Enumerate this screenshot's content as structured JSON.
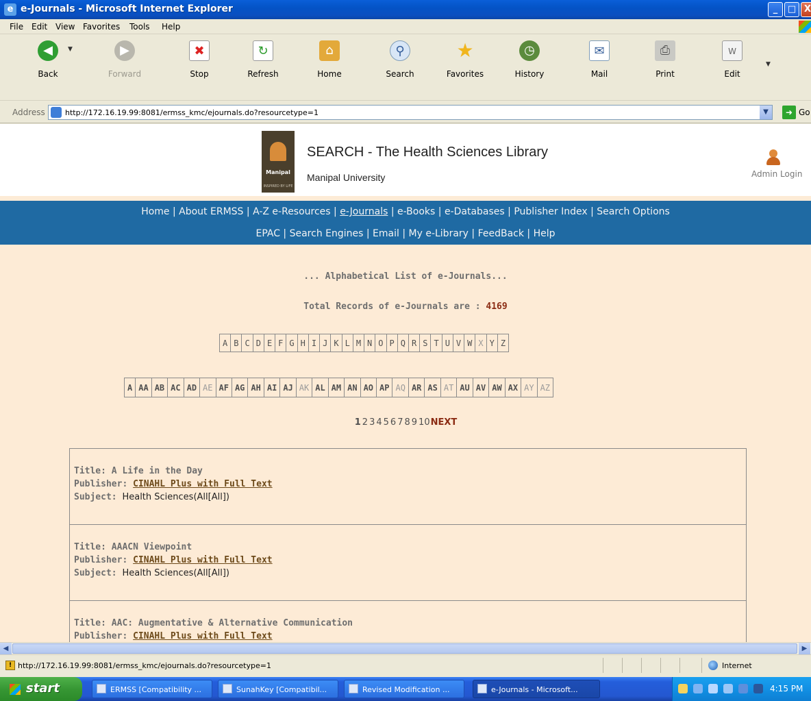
{
  "window": {
    "title": "e-Journals - Microsoft Internet Explorer",
    "minimize": "_",
    "maximize": "□",
    "close": "X"
  },
  "menu": [
    "File",
    "Edit",
    "View",
    "Favorites",
    "Tools",
    "Help"
  ],
  "toolbar": {
    "back": "Back",
    "forward": "Forward",
    "stop": "Stop",
    "refresh": "Refresh",
    "home": "Home",
    "search": "Search",
    "favorites": "Favorites",
    "history": "History",
    "mail": "Mail",
    "print": "Print",
    "edit": "Edit"
  },
  "address": {
    "label": "Address",
    "url": "http://172.16.19.99:8081/ermss_kmc/ejournals.do?resourcetype=1",
    "go": "Go"
  },
  "site": {
    "logo_name": "Manipal",
    "logo_tagline": "INSPIRED BY LIFE",
    "title": "SEARCH - The Health Sciences Library",
    "subtitle": "Manipal University",
    "admin_login": "Admin Login"
  },
  "nav": {
    "row1": [
      {
        "label": "Home",
        "current": false
      },
      {
        "label": "About ERMSS",
        "current": false
      },
      {
        "label": "A-Z e-Resources",
        "current": false
      },
      {
        "label": "e-Journals",
        "current": true
      },
      {
        "label": "e-Books",
        "current": false
      },
      {
        "label": "e-Databases",
        "current": false
      },
      {
        "label": "Publisher Index",
        "current": false
      },
      {
        "label": "Search Options",
        "current": false
      }
    ],
    "row2": [
      {
        "label": "EPAC",
        "current": false
      },
      {
        "label": "Search Engines",
        "current": false
      },
      {
        "label": "Email",
        "current": false
      },
      {
        "label": "My e-Library",
        "current": false
      },
      {
        "label": "FeedBack",
        "current": false
      },
      {
        "label": "Help",
        "current": false
      }
    ],
    "separator": "|"
  },
  "list": {
    "heading": "... Alphabetical List of e-Journals...",
    "total_label": "Total Records of e-Journals are :",
    "total_count": "4169"
  },
  "letters_row1": [
    {
      "t": "A",
      "dim": false
    },
    {
      "t": "B",
      "dim": false
    },
    {
      "t": "C",
      "dim": false
    },
    {
      "t": "D",
      "dim": false
    },
    {
      "t": "E",
      "dim": false
    },
    {
      "t": "F",
      "dim": false
    },
    {
      "t": "G",
      "dim": false
    },
    {
      "t": "H",
      "dim": false
    },
    {
      "t": "I",
      "dim": false
    },
    {
      "t": "J",
      "dim": false
    },
    {
      "t": "K",
      "dim": false
    },
    {
      "t": "L",
      "dim": false
    },
    {
      "t": "M",
      "dim": false
    },
    {
      "t": "N",
      "dim": false
    },
    {
      "t": "O",
      "dim": false
    },
    {
      "t": "P",
      "dim": false
    },
    {
      "t": "Q",
      "dim": false
    },
    {
      "t": "R",
      "dim": false
    },
    {
      "t": "S",
      "dim": false
    },
    {
      "t": "T",
      "dim": false
    },
    {
      "t": "U",
      "dim": false
    },
    {
      "t": "V",
      "dim": false
    },
    {
      "t": "W",
      "dim": false
    },
    {
      "t": "X",
      "dim": true
    },
    {
      "t": "Y",
      "dim": false
    },
    {
      "t": "Z",
      "dim": false
    }
  ],
  "letters_row2": [
    {
      "t": "A",
      "dim": false
    },
    {
      "t": "AA",
      "dim": false
    },
    {
      "t": "AB",
      "dim": false
    },
    {
      "t": "AC",
      "dim": false
    },
    {
      "t": "AD",
      "dim": false
    },
    {
      "t": "AE",
      "dim": true
    },
    {
      "t": "AF",
      "dim": false
    },
    {
      "t": "AG",
      "dim": false
    },
    {
      "t": "AH",
      "dim": false
    },
    {
      "t": "AI",
      "dim": false
    },
    {
      "t": "AJ",
      "dim": false
    },
    {
      "t": "AK",
      "dim": true
    },
    {
      "t": "AL",
      "dim": false
    },
    {
      "t": "AM",
      "dim": false
    },
    {
      "t": "AN",
      "dim": false
    },
    {
      "t": "AO",
      "dim": false
    },
    {
      "t": "AP",
      "dim": false
    },
    {
      "t": "AQ",
      "dim": true
    },
    {
      "t": "AR",
      "dim": false
    },
    {
      "t": "AS",
      "dim": false
    },
    {
      "t": "AT",
      "dim": true
    },
    {
      "t": "AU",
      "dim": false
    },
    {
      "t": "AV",
      "dim": false
    },
    {
      "t": "AW",
      "dim": false
    },
    {
      "t": "AX",
      "dim": false
    },
    {
      "t": "AY",
      "dim": true
    },
    {
      "t": "AZ",
      "dim": true
    }
  ],
  "pager": {
    "pages": [
      "1",
      "2",
      "3",
      "4",
      "5",
      "6",
      "7",
      "8",
      "9",
      "10"
    ],
    "current": "1",
    "next": "NEXT"
  },
  "records": [
    {
      "title_label": "Title:",
      "title": "A Life in the Day",
      "publisher_label": "Publisher:",
      "publisher": "CINAHL Plus with Full Text",
      "subject_label": "Subject:",
      "subject": "Health Sciences(All[All])"
    },
    {
      "title_label": "Title:",
      "title": "AAACN Viewpoint",
      "publisher_label": "Publisher:",
      "publisher": "CINAHL Plus with Full Text",
      "subject_label": "Subject:",
      "subject": "Health Sciences(All[All])"
    },
    {
      "title_label": "Title:",
      "title": "AAC: Augmentative & Alternative Communication",
      "publisher_label": "Publisher:",
      "publisher": "CINAHL Plus with Full Text",
      "subject_label": "Subject:",
      "subject": ""
    }
  ],
  "status": {
    "url": "http://172.16.19.99:8081/ermss_kmc/ejournals.do?resourcetype=1",
    "zone": "Internet"
  },
  "taskbar": {
    "start": "start",
    "tasks": [
      {
        "label": "ERMSS [Compatibility ...",
        "active": false
      },
      {
        "label": "SunahKey [Compatibil...",
        "active": false
      },
      {
        "label": "Revised Modification ...",
        "active": false
      },
      {
        "label": "e-Journals - Microsoft...",
        "active": true
      }
    ],
    "clock": "4:15 PM"
  }
}
